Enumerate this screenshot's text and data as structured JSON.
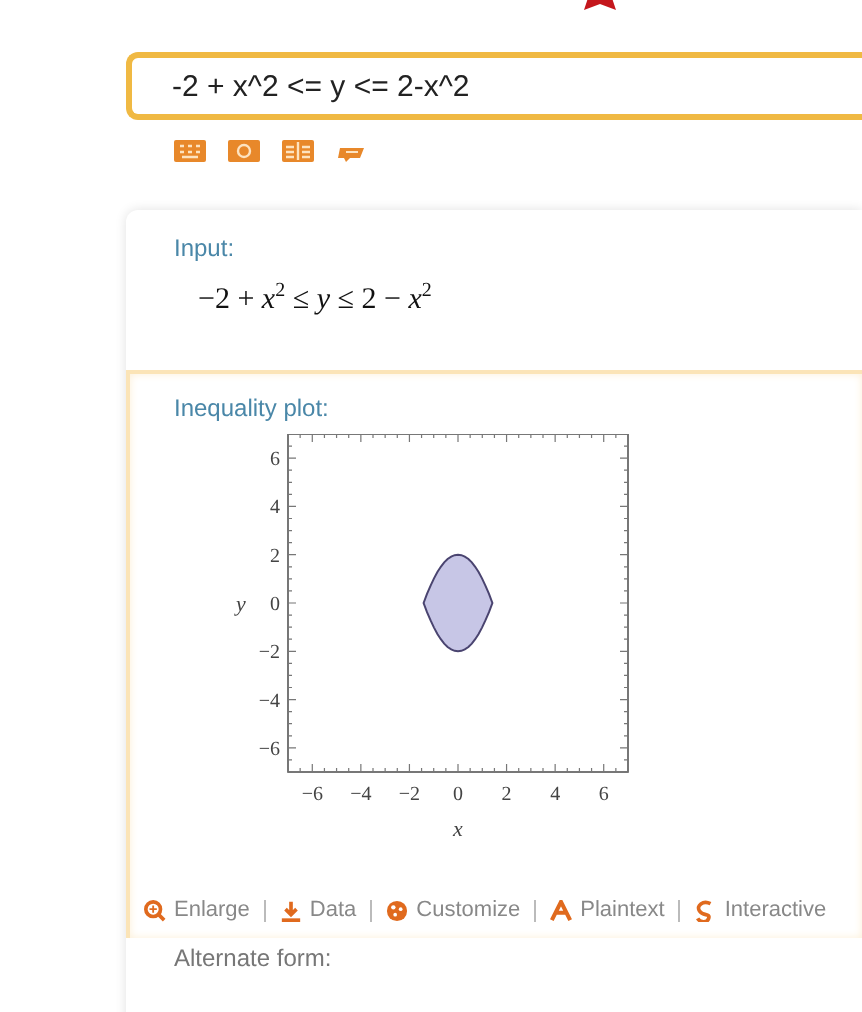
{
  "query": {
    "value": "-2 + x^2 <= y <= 2-x^2"
  },
  "pods": [
    {
      "kind": "math",
      "title": "Input:",
      "math": "−2 + *x*$^{2}$ ≤ *y* ≤ 2 − *x*$^{2}$"
    },
    {
      "kind": "plot",
      "title": "Inequality plot:",
      "plot": {
        "xlabel": "x",
        "ylabel": "y",
        "xticks": [
          "−6",
          "−4",
          "−2",
          "0",
          "2",
          "4",
          "6"
        ],
        "yticks": [
          "6",
          "4",
          "2",
          "0",
          "−2",
          "−4",
          "−6"
        ]
      },
      "actions": [
        {
          "kind": "enlarge",
          "label": "Enlarge"
        },
        {
          "kind": "data",
          "label": "Data"
        },
        {
          "kind": "customize",
          "label": "Customize"
        },
        {
          "kind": "plaintext",
          "label": "Plaintext"
        },
        {
          "kind": "interactive",
          "label": "Interactive"
        }
      ]
    }
  ],
  "next_pod_title": "Alternate form:"
}
